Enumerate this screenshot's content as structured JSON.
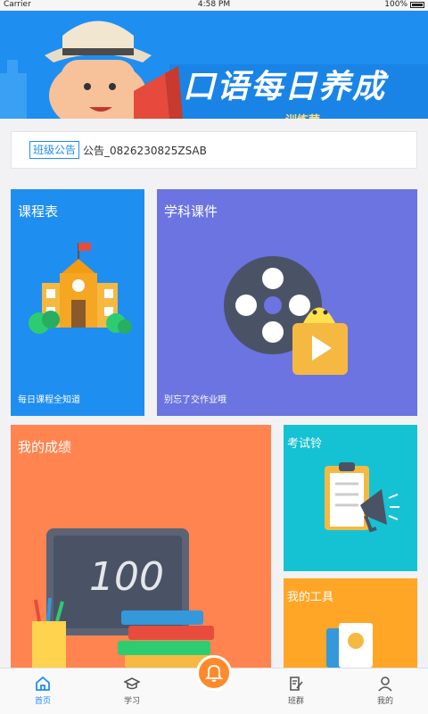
{
  "status_bar": {
    "carrier": "Carrier",
    "time": "4:58 PM",
    "battery": "100%"
  },
  "banner": {
    "title": "口语每日养成",
    "subtitle": "训练营"
  },
  "notice": {
    "tag": "班级公告",
    "text": "公告_0826230825ZSAB"
  },
  "tiles": {
    "schedule": {
      "title": "课程表",
      "caption": "每日课程全知道"
    },
    "courseware": {
      "title": "学科课件",
      "caption": "别忘了交作业哦"
    },
    "grades": {
      "title": "我的成绩",
      "board_text": "100"
    },
    "exam": {
      "title": "考试铃"
    },
    "tools": {
      "title": "我的工具"
    }
  },
  "tabs": [
    {
      "label": "首页",
      "icon": "home-icon",
      "active": true
    },
    {
      "label": "学习",
      "icon": "graduation-cap-icon",
      "active": false
    },
    {
      "label": "",
      "icon": "bell-icon",
      "active": false
    },
    {
      "label": "班群",
      "icon": "edit-note-icon",
      "active": false
    },
    {
      "label": "我的",
      "icon": "user-icon",
      "active": false
    }
  ],
  "colors": {
    "primary_blue": "#1f8ef1",
    "purple": "#6b74e0",
    "orange": "#ff8450",
    "cyan": "#15c2d3",
    "amber": "#ffa627",
    "bell_orange": "#ff8a2c"
  }
}
